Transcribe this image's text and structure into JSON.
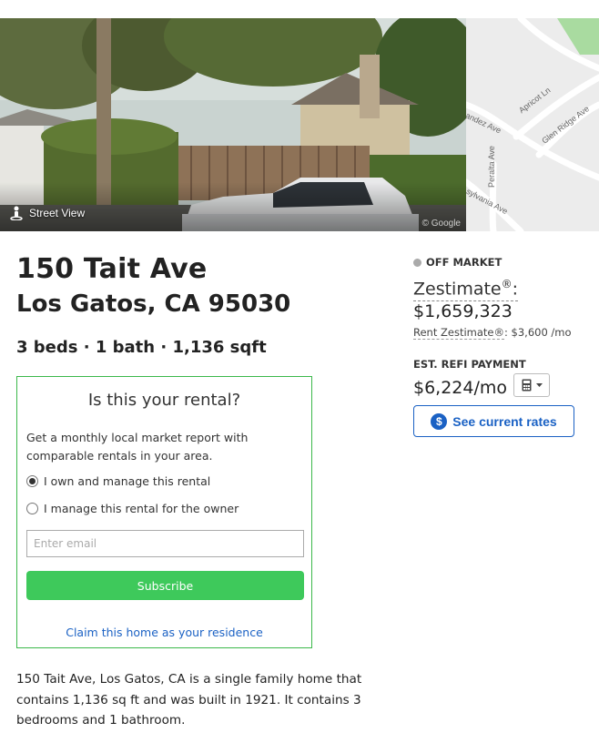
{
  "hero": {
    "street_view_label": "Street View",
    "google_mark": "© Google",
    "map_streets": [
      "Apricot Ln",
      "Glen Ridge Ave",
      "andez Ave",
      "Peralta Ave",
      "sylvania Ave"
    ]
  },
  "property": {
    "address_line1": "150 Tait Ave",
    "address_line2": "Los Gatos, CA 95030",
    "facts": "3 beds · 1 bath · 1,136 sqft",
    "summary": "150 Tait Ave, Los Gatos, CA is a single family home that contains 1,136 sq ft and was built in 1921. It contains 3 bedrooms and 1 bathroom."
  },
  "rental_card": {
    "title": "Is this your rental?",
    "description": "Get a monthly local market report with comparable rentals in your area.",
    "options": [
      {
        "label": "I own and manage this rental",
        "checked": true
      },
      {
        "label": "I manage this rental for the owner",
        "checked": false
      }
    ],
    "email_placeholder": "Enter email",
    "subscribe_label": "Subscribe",
    "claim_link": "Claim this home as your residence"
  },
  "pricing": {
    "status": "OFF MARKET",
    "status_color": "#aaaaaa",
    "zestimate_label": "Zestimate",
    "zestimate_sup": "®",
    "zestimate_colon": ":",
    "zestimate_value": "$1,659,323",
    "rent_label": "Rent Zestimate®",
    "rent_value": ": $3,600 /mo",
    "refi_label": "EST. REFI PAYMENT",
    "refi_value": "$6,224/mo",
    "calc_icon": "calculator-icon",
    "rates_button": "See current rates",
    "rates_icon": "dollar-icon"
  },
  "colors": {
    "accent_green": "#3ec95b",
    "card_border": "#3bb84a",
    "link_blue": "#1a61c4"
  }
}
